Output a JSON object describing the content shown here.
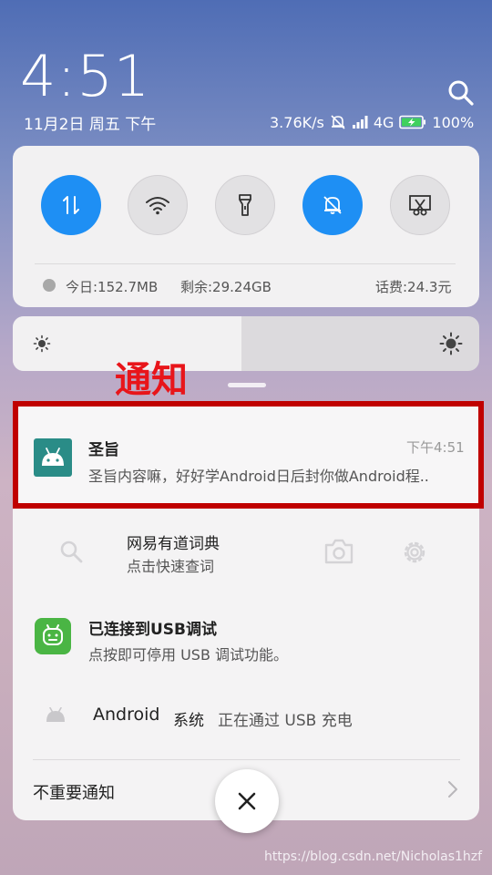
{
  "status_bar": {
    "clock": "4:51",
    "date": "11月2日 周五 下午",
    "network_speed": "3.76K/s",
    "network_type": "4G",
    "battery": "100%"
  },
  "quick_settings": {
    "toggles": [
      {
        "name": "data",
        "state": "on"
      },
      {
        "name": "wifi",
        "state": "off"
      },
      {
        "name": "flashlight",
        "state": "off"
      },
      {
        "name": "mute",
        "state": "on"
      },
      {
        "name": "screenshot",
        "state": "off"
      }
    ],
    "usage_today": "今日:152.7MB",
    "remaining": "剩余:29.24GB",
    "balance": "话费:24.3元"
  },
  "brightness": {
    "level": 0.49
  },
  "annotation": {
    "label": "通知"
  },
  "notifications": [
    {
      "app_icon": "android-icon",
      "title": "圣旨",
      "body": "圣旨内容嘛，好好学Android日后封你做Android程..",
      "time": "下午4:51"
    },
    {
      "title": "网易有道词典",
      "subtitle": "点击快速查词"
    },
    {
      "app_icon": "android-icon",
      "title": "已连接到USB调试",
      "body": "点按即可停用 USB 调试功能。"
    },
    {
      "app": "Android",
      "app_suffix": "系统",
      "body": "正在通过 USB 充电"
    }
  ],
  "unimportant_label": "不重要通知",
  "watermark": "https://blog.csdn.net/Nicholas1hzf",
  "colors": {
    "accent": "#1e8ff4",
    "annotation_red": "#e8151a",
    "highlight_red": "#c00000",
    "usb_green": "#4ab544",
    "app_teal": "#2a8c87"
  }
}
